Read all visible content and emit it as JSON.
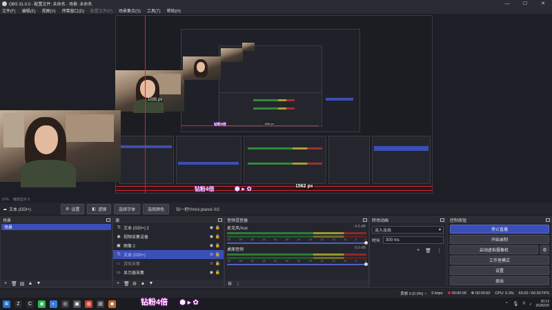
{
  "window": {
    "title": "OBS 31.0.0 - 配置文件: 未命名 - 场景: 未命名",
    "controls": [
      "—",
      "☐",
      "✕"
    ]
  },
  "menu": [
    "文件(F)",
    "编辑(E)",
    "视图(V)",
    "停靠窗口(D)",
    "配置文件(P)",
    "场景集合(S)",
    "工具(T)",
    "帮助(H)"
  ],
  "preview": {
    "left_measure": "1035 px",
    "bottom_measure": "1562 px",
    "nested_measure": "1562 px",
    "overlay_text": "钻粉4倍",
    "nested_overlay_text": "钻粉4倍",
    "zoom": "57%",
    "zoom_hint": "缩放显示 0"
  },
  "source_toolbar": {
    "source_name": "文本 (GDI+)",
    "buttons": [
      "设置",
      "滤镜",
      "选择字体",
      "选择颜色"
    ],
    "text_preview": "钻一把!!!mini planck 0/2"
  },
  "scenes": {
    "title": "场景",
    "items": [
      "场景"
    ]
  },
  "sources": {
    "title": "源",
    "items": [
      {
        "icon": "text-icon",
        "glyph": "Tt",
        "label": "文本 (GDI+) 2",
        "visible": true
      },
      {
        "icon": "camera-icon",
        "glyph": "◉",
        "label": "视频采集设备",
        "visible": true
      },
      {
        "icon": "image-icon",
        "glyph": "▣",
        "label": "图像 2",
        "visible": true
      },
      {
        "icon": "text-icon",
        "glyph": "Tt",
        "label": "文本 (GDI+)",
        "visible": false,
        "selected": true
      },
      {
        "icon": "window-icon",
        "glyph": "▭",
        "label": "游戏采集",
        "visible": false
      },
      {
        "icon": "monitor-icon",
        "glyph": "▭",
        "label": "显示器采集",
        "visible": true
      }
    ]
  },
  "mixer": {
    "title": "音频混音器",
    "tracks": [
      {
        "name": "麦克风/Aux",
        "db": "-4.0 dB"
      },
      {
        "name": "桌面音频",
        "db": "0.0 dB"
      }
    ],
    "ticks": [
      "-60",
      "-55",
      "-50",
      "-45",
      "-40",
      "-35",
      "-30",
      "-25",
      "-20",
      "-15",
      "-10",
      "-5",
      "0"
    ]
  },
  "transitions": {
    "title": "转场动画",
    "selected": "淡入淡出",
    "duration_label": "时长",
    "duration_value": "300 ms"
  },
  "controls": {
    "title": "控制按钮",
    "stop_stream": "停止直播",
    "start_record": "开始录制",
    "virtual_cam": "启动虚拟摄像机",
    "studio_mode": "工作室模式",
    "settings": "设置",
    "exit": "退出"
  },
  "status": {
    "dropped_frames": "丢帧 0 (0.0%)",
    "bitrate": "0 kbps",
    "live_time": "00:00:00",
    "rec_time": "00:00:00",
    "cpu": "CPU: 0.3%",
    "fps": "60.00 / 60.00 FPS"
  },
  "taskbar": {
    "sticker": "钻粉4倍",
    "time": "20:13",
    "date": "2026/2/6"
  },
  "colors": {
    "accent": "#3b4fb8",
    "record_red": "#e0202a",
    "bg": "#1e1f26",
    "panel": "#25262d"
  }
}
